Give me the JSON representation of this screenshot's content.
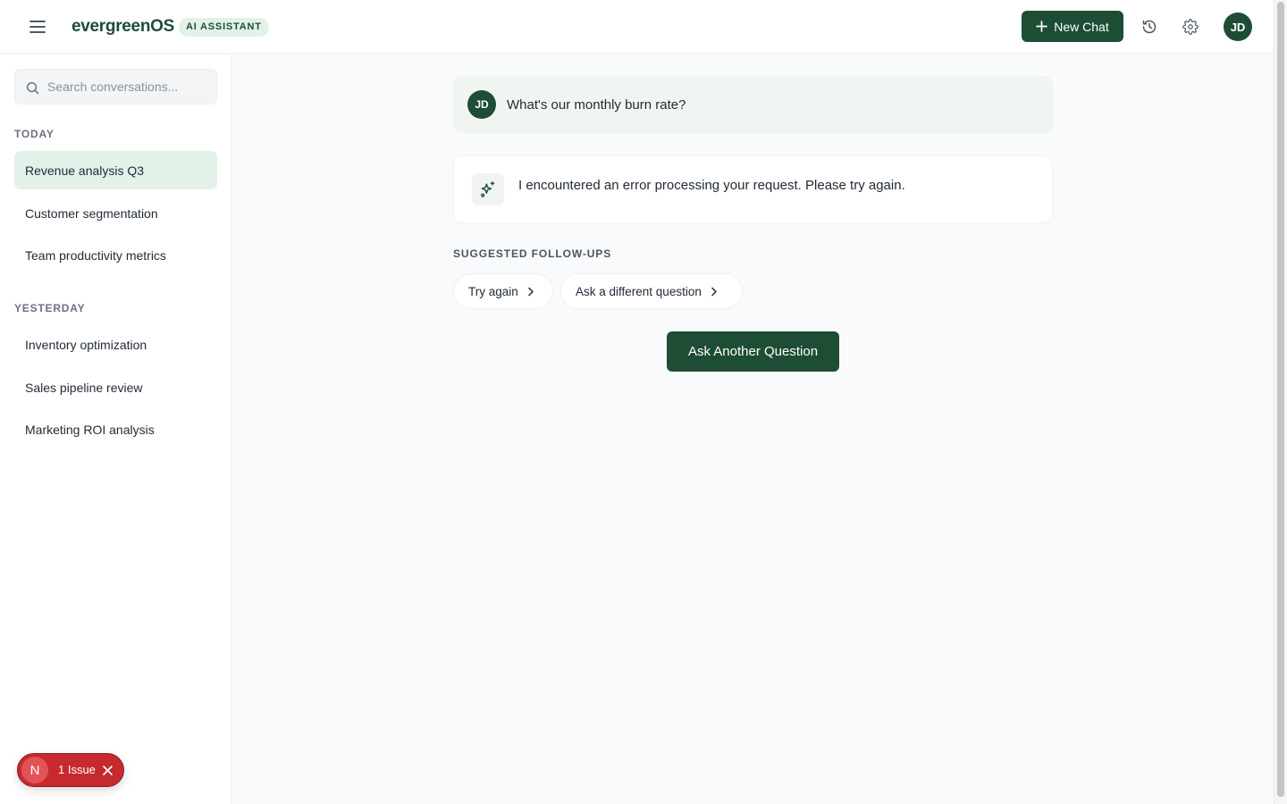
{
  "header": {
    "brand": "evergreenOS",
    "badge": "AI ASSISTANT",
    "new_chat_label": "New Chat",
    "user_initials": "JD",
    "icons": {
      "menu": "menu-icon",
      "plus": "plus-icon",
      "history": "history-icon",
      "settings": "gear-icon"
    }
  },
  "sidebar": {
    "search_placeholder": "Search conversations...",
    "sections": [
      {
        "label": "TODAY",
        "items": [
          {
            "label": "Revenue analysis Q3",
            "active": true
          },
          {
            "label": "Customer segmentation"
          },
          {
            "label": "Team productivity metrics"
          }
        ]
      },
      {
        "label": "YESTERDAY",
        "items": [
          {
            "label": "Inventory optimization"
          },
          {
            "label": "Sales pipeline review"
          },
          {
            "label": "Marketing ROI analysis"
          }
        ]
      }
    ]
  },
  "chat": {
    "user_message": {
      "initials": "JD",
      "text": "What's our monthly burn rate?"
    },
    "ai_message": {
      "icon": "sparkles-icon",
      "text": "I encountered an error processing your request. Please try again."
    },
    "followups_label": "SUGGESTED FOLLOW-UPS",
    "followups": [
      "Try again",
      "Ask a different question"
    ],
    "ask_another_label": "Ask Another Question"
  },
  "dev_overlay": {
    "letter": "N",
    "issue_text": "1 Issue"
  },
  "colors": {
    "brand": "#1e4d36",
    "active_bg": "#e3f2e9",
    "issue_red": "#c62a2f"
  }
}
